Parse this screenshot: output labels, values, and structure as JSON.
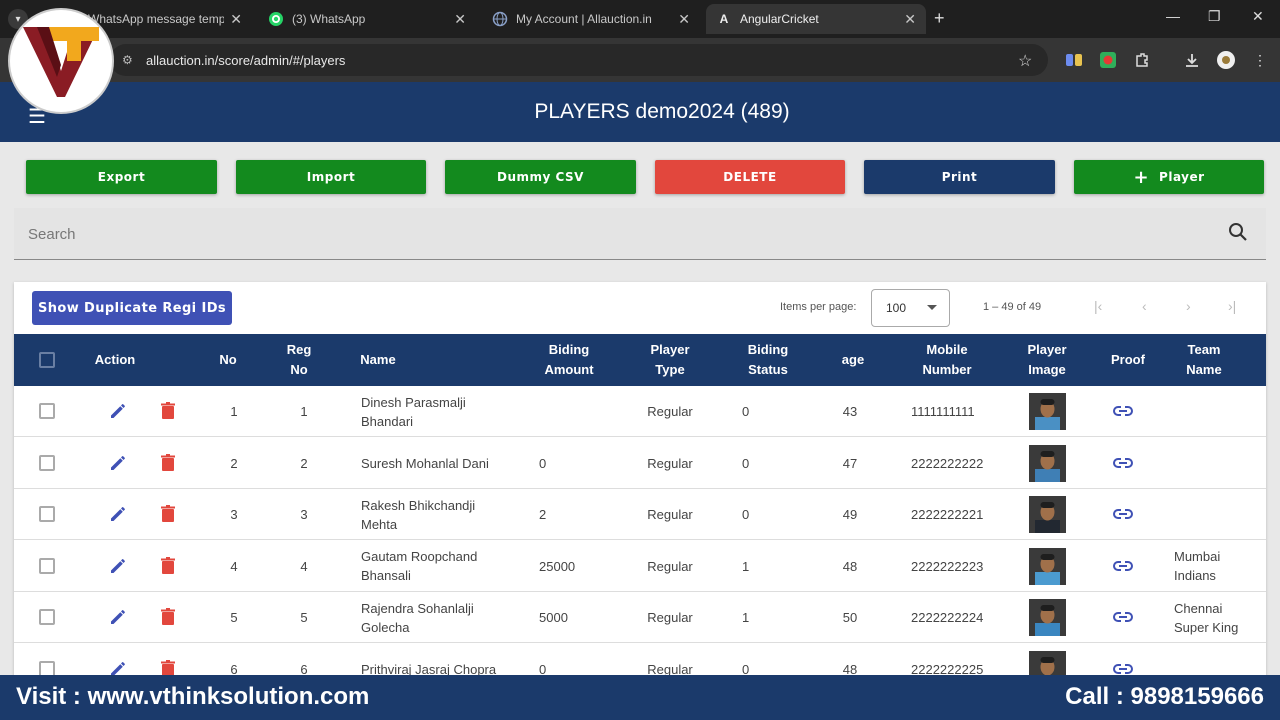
{
  "browser": {
    "tabs": [
      {
        "title": "WhatsApp message templ",
        "icon": "whatsapp-template-icon"
      },
      {
        "title": "(3) WhatsApp",
        "icon": "whatsapp-icon"
      },
      {
        "title": "My Account | Allauction.in",
        "icon": "globe-icon"
      },
      {
        "title": "AngularCricket",
        "icon": "angular-icon"
      }
    ],
    "url": "allauction.in/score/admin/#/players"
  },
  "header": {
    "title": "PLAYERS demo2024 (489)"
  },
  "toolbar": {
    "export": "Export",
    "import": "Import",
    "dummy_csv": "Dummy CSV",
    "delete": "DELETE",
    "print": "Print",
    "add_player": "Player"
  },
  "search": {
    "placeholder": "Search"
  },
  "table_controls": {
    "duplicate_btn": "Show Duplicate Regi IDs",
    "items_per_page_label": "Items per page:",
    "items_per_page": "100",
    "range": "1 – 49 of 49"
  },
  "columns": {
    "action": "Action",
    "no": "No",
    "reg_no_1": "Reg",
    "reg_no_2": "No",
    "name": "Name",
    "biding_amount_1": "Biding",
    "biding_amount_2": "Amount",
    "player_type_1": "Player",
    "player_type_2": "Type",
    "biding_status_1": "Biding",
    "biding_status_2": "Status",
    "age": "age",
    "mobile_1": "Mobile",
    "mobile_2": "Number",
    "player_image_1": "Player",
    "player_image_2": "Image",
    "proof": "Proof",
    "team_1": "Team",
    "team_2": "Name"
  },
  "rows": [
    {
      "no": "1",
      "reg": "1",
      "name1": "Dinesh Parasmalji",
      "name2": "Bhandari",
      "amount": "",
      "type": "Regular",
      "status": "0",
      "age": "43",
      "mobile": "1111111111",
      "team1": "",
      "team2": ""
    },
    {
      "no": "2",
      "reg": "2",
      "name1": "Suresh Mohanlal Dani",
      "name2": "",
      "amount": "0",
      "type": "Regular",
      "status": "0",
      "age": "47",
      "mobile": "2222222222",
      "team1": "",
      "team2": ""
    },
    {
      "no": "3",
      "reg": "3",
      "name1": "Rakesh Bhikchandji",
      "name2": "Mehta",
      "amount": "2",
      "type": "Regular",
      "status": "0",
      "age": "49",
      "mobile": "2222222221",
      "team1": "",
      "team2": ""
    },
    {
      "no": "4",
      "reg": "4",
      "name1": "Gautam Roopchand",
      "name2": "Bhansali",
      "amount": "25000",
      "type": "Regular",
      "status": "1",
      "age": "48",
      "mobile": "2222222223",
      "team1": "Mumbai",
      "team2": "Indians"
    },
    {
      "no": "5",
      "reg": "5",
      "name1": "Rajendra Sohanlalji",
      "name2": "Golecha",
      "amount": "5000",
      "type": "Regular",
      "status": "1",
      "age": "50",
      "mobile": "2222222224",
      "team1": "Chennai",
      "team2": "Super King"
    },
    {
      "no": "6",
      "reg": "6",
      "name1": "Prithviraj Jasraj Chopra",
      "name2": "",
      "amount": "0",
      "type": "Regular",
      "status": "0",
      "age": "48",
      "mobile": "2222222225",
      "team1": "",
      "team2": ""
    }
  ],
  "banner": {
    "visit": "Visit : www.vthinksolution.com",
    "call": "Call : 9898159666"
  },
  "colors": {
    "navy": "#1b3a6b",
    "green": "#138a1e",
    "red": "#e2473d",
    "indigo": "#3f51b5"
  }
}
